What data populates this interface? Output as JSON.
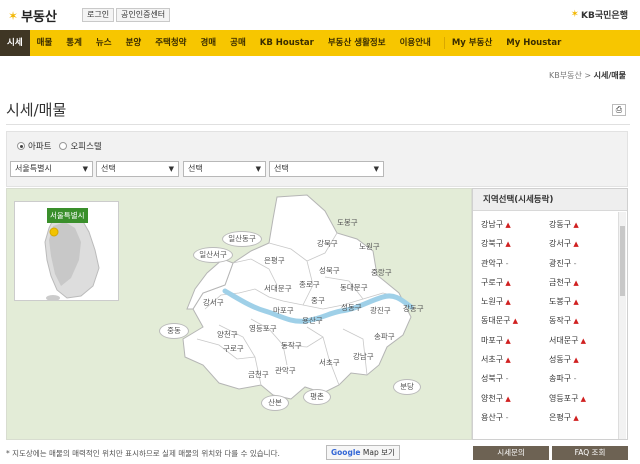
{
  "header": {
    "logo_text": "부동산",
    "login_label": "로그인",
    "cert_label": "공인인증센터",
    "bank_name": "KB국민은행"
  },
  "nav": {
    "items": [
      "시세",
      "매물",
      "통계",
      "뉴스",
      "분양",
      "주택청약",
      "경매",
      "공매",
      "KB Houstar",
      "부동산 생활정보",
      "이용안내"
    ],
    "right_items": [
      "My 부동산",
      "My Houstar"
    ],
    "active_index": 0
  },
  "breadcrumb": {
    "parent": "KB부동산",
    "current": "시세/매물"
  },
  "page_title": "시세/매물",
  "filter": {
    "radio_apartment": "아파트",
    "radio_officetel": "오피스텔",
    "select_city": "서울특별시",
    "select_2": "선택",
    "select_3": "선택",
    "select_4": "선택"
  },
  "map": {
    "inset_label": "서울특별시",
    "districts": [
      "도봉구",
      "강북구",
      "노원구",
      "은평구",
      "성북구",
      "중랑구",
      "종로구",
      "동대문구",
      "서대문구",
      "중구",
      "마포구",
      "성동구",
      "광진구",
      "강동구",
      "용산구",
      "강서구",
      "영등포구",
      "동작구",
      "양천구",
      "구로구",
      "서초구",
      "강남구",
      "송파구",
      "관악구",
      "금천구"
    ],
    "outer": [
      "일산동구",
      "일산서구",
      "중동",
      "산본",
      "평촌",
      "분당"
    ]
  },
  "region_panel": {
    "title": "지역선택(시세등락)",
    "rows": [
      [
        {
          "name": "강남구",
          "trend": "up"
        },
        {
          "name": "강동구",
          "trend": "up"
        }
      ],
      [
        {
          "name": "강북구",
          "trend": "up"
        },
        {
          "name": "강서구",
          "trend": "up"
        }
      ],
      [
        {
          "name": "관악구",
          "trend": "flat"
        },
        {
          "name": "광진구",
          "trend": "flat"
        }
      ],
      [
        {
          "name": "구로구",
          "trend": "up"
        },
        {
          "name": "금천구",
          "trend": "up"
        }
      ],
      [
        {
          "name": "노원구",
          "trend": "up"
        },
        {
          "name": "도봉구",
          "trend": "up"
        }
      ],
      [
        {
          "name": "동대문구",
          "trend": "up"
        },
        {
          "name": "동작구",
          "trend": "up"
        }
      ],
      [
        {
          "name": "마포구",
          "trend": "up"
        },
        {
          "name": "서대문구",
          "trend": "up"
        }
      ],
      [
        {
          "name": "서초구",
          "trend": "up"
        },
        {
          "name": "성동구",
          "trend": "up"
        }
      ],
      [
        {
          "name": "성북구",
          "trend": "flat"
        },
        {
          "name": "송파구",
          "trend": "flat"
        }
      ],
      [
        {
          "name": "양천구",
          "trend": "up"
        },
        {
          "name": "영등포구",
          "trend": "up"
        }
      ],
      [
        {
          "name": "용산구",
          "trend": "flat"
        },
        {
          "name": "은평구",
          "trend": "up"
        }
      ]
    ]
  },
  "footer": {
    "note": "* 지도상에는 매물의 매력적인 위치만 표시하므로 실제 매물의 위치와 다를 수 있습니다.",
    "gmap_google": "Google",
    "gmap_label": "Map 보기",
    "btn_inquiry": "시세문의",
    "btn_faq": "FAQ 조회"
  },
  "colors": {
    "nav_bg": "#f7c600",
    "nav_active": "#3f3624",
    "up_arrow": "#d02020",
    "district_fill": "#ffffff",
    "map_bg": "#e3ecd7",
    "river": "#9fd0e8"
  }
}
